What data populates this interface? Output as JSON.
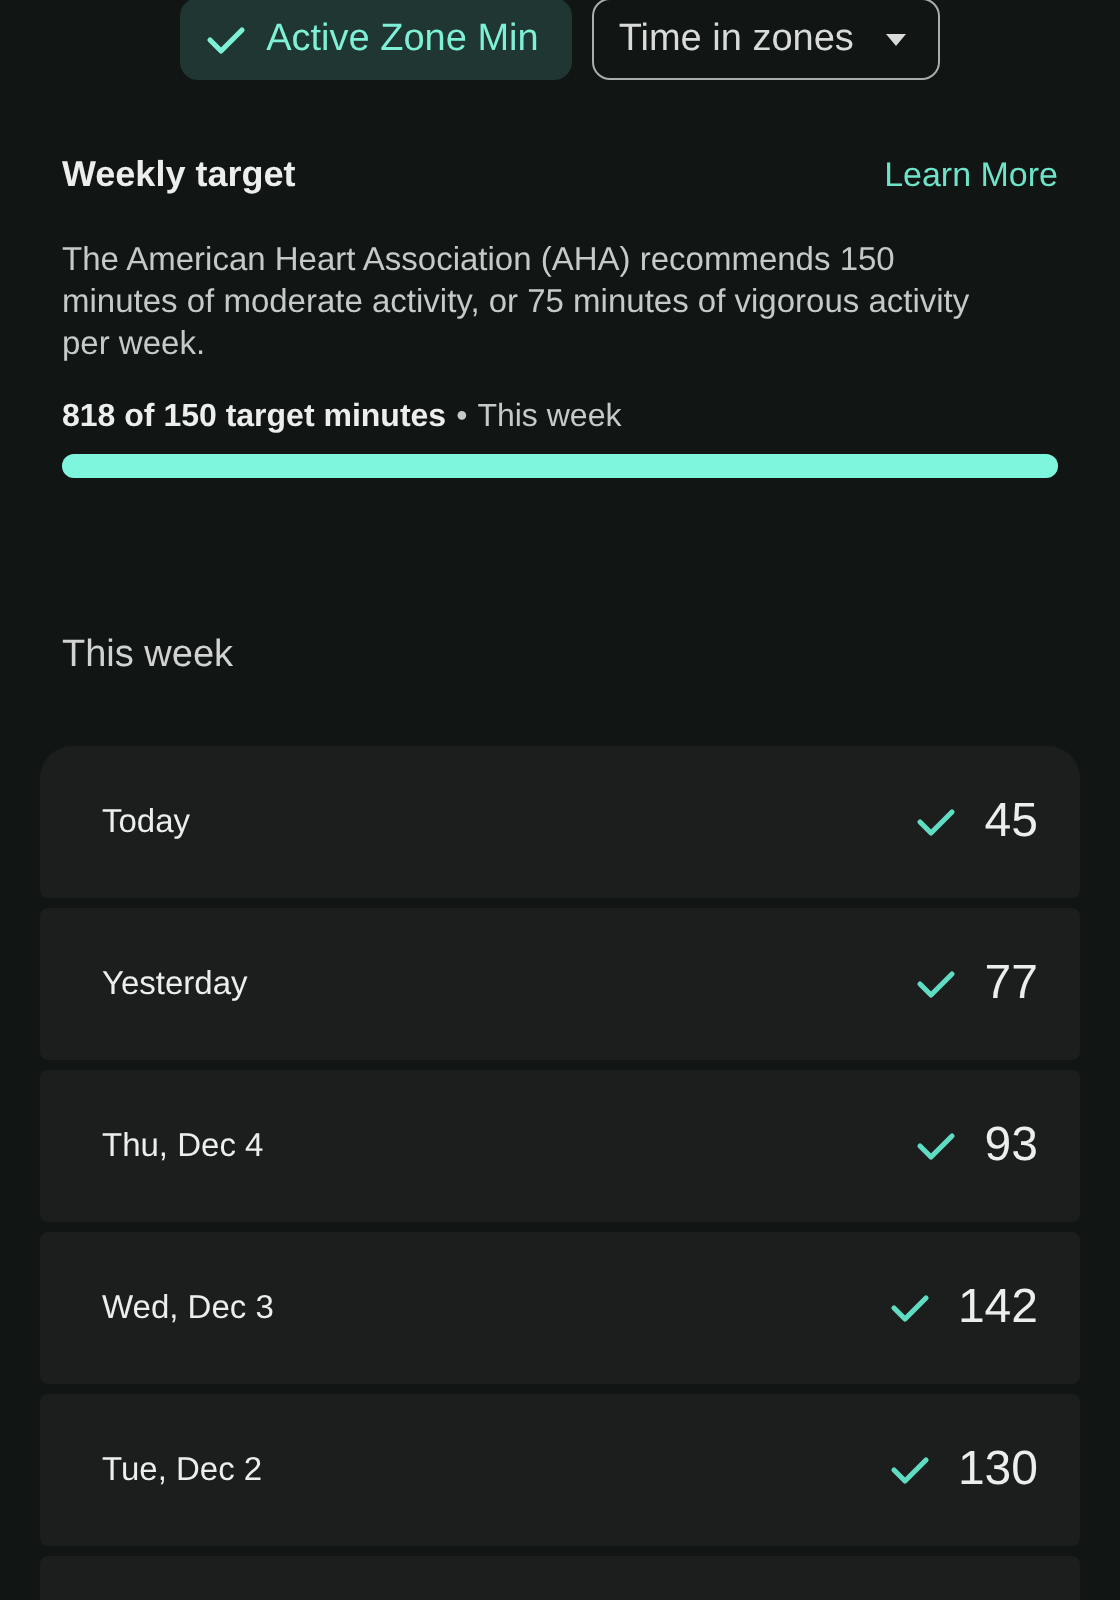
{
  "chips": [
    {
      "label": "Active Zone Min",
      "selected": true,
      "kind": "toggle"
    },
    {
      "label": "Time in zones",
      "selected": false,
      "kind": "dropdown"
    }
  ],
  "weekly_target": {
    "title": "Weekly target",
    "link": "Learn More",
    "description": "The American Heart Association (AHA) recommends 150 minutes of moderate activity, or 75 minutes of vigorous activity per week.",
    "progress_label": "818 of 150 target minutes",
    "progress_separator": "•",
    "progress_period": "This week",
    "level": 1
  },
  "this_week": {
    "title": "This week",
    "days": [
      {
        "label": "Today",
        "value": "45",
        "met": true
      },
      {
        "label": "Yesterday",
        "value": "77",
        "met": true
      },
      {
        "label": "Thu, Dec 4",
        "value": "93",
        "met": true
      },
      {
        "label": "Wed, Dec 3",
        "value": "142",
        "met": true
      },
      {
        "label": "Tue, Dec 2",
        "value": "130",
        "met": true
      }
    ]
  }
}
